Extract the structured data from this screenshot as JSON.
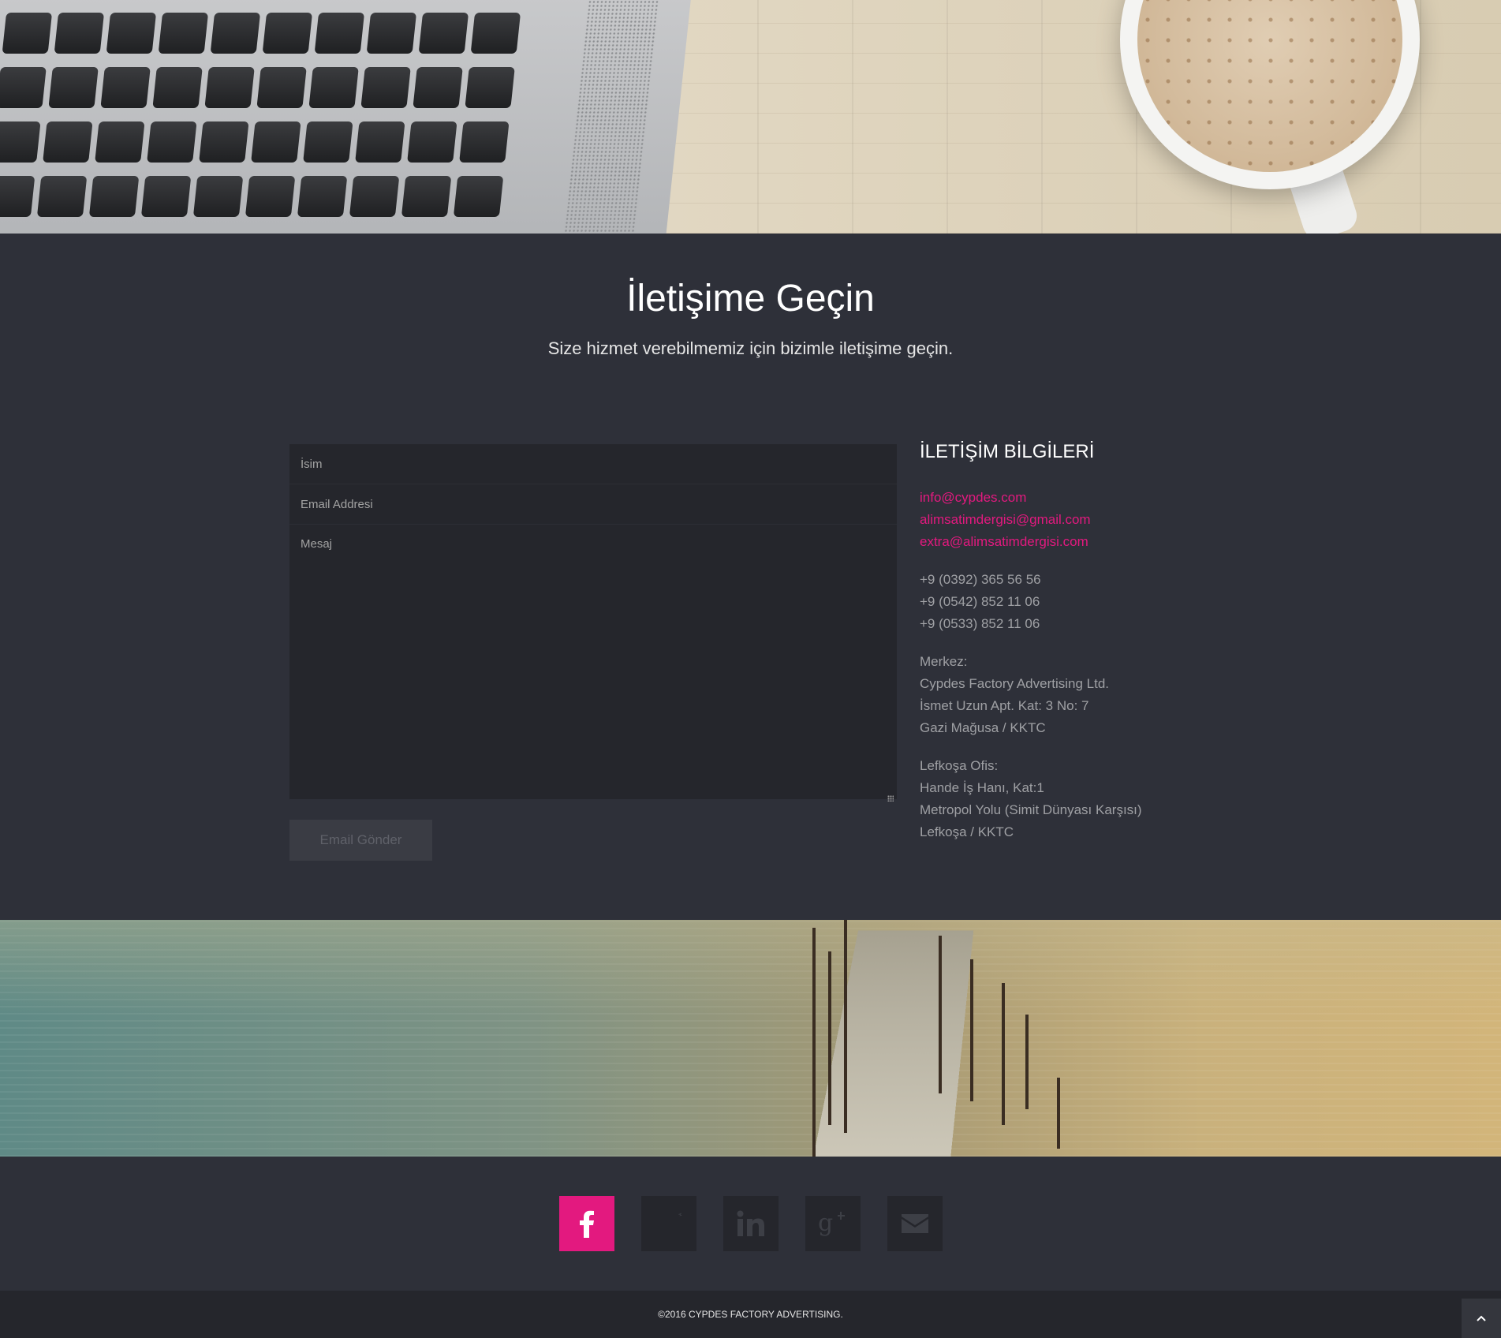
{
  "contact": {
    "title": "İletişime Geçin",
    "subtitle": "Size hizmet verebilmemiz için bizimle iletişime geçin."
  },
  "form": {
    "name_placeholder": "İsim",
    "email_placeholder": "Email Addresi",
    "message_placeholder": "Mesaj",
    "send_label": "Email Gönder"
  },
  "info": {
    "title": "İLETİŞİM BİLGİLERİ",
    "emails": [
      "info@cypdes.com",
      "alimsatimdergisi@gmail.com",
      "extra@alimsatimdergisi.com"
    ],
    "phones": [
      "+9 (0392) 365 56 56",
      "+9 (0542) 852 11 06",
      "+9 (0533) 852 11 06"
    ],
    "hq": [
      "Merkez:",
      "Cypdes Factory Advertising Ltd.",
      "İsmet Uzun Apt. Kat: 3 No: 7",
      "Gazi Mağusa / KKTC"
    ],
    "office": [
      "Lefkoşa Ofis:",
      "Hande İş Hanı, Kat:1",
      "Metropol Yolu (Simit Dünyası Karşısı)",
      "Lefkoşa / KKTC"
    ]
  },
  "social": {
    "icons": [
      "facebook-icon",
      "twitter-icon",
      "linkedin-icon",
      "google-plus-icon",
      "email-icon"
    ],
    "active_color": "#e3197f"
  },
  "footer": {
    "copyright": "©2016 CYPDES FACTORY ADVERTISING."
  },
  "colors": {
    "background": "#2e3039",
    "field": "#25262c",
    "accent": "#e3197f"
  }
}
